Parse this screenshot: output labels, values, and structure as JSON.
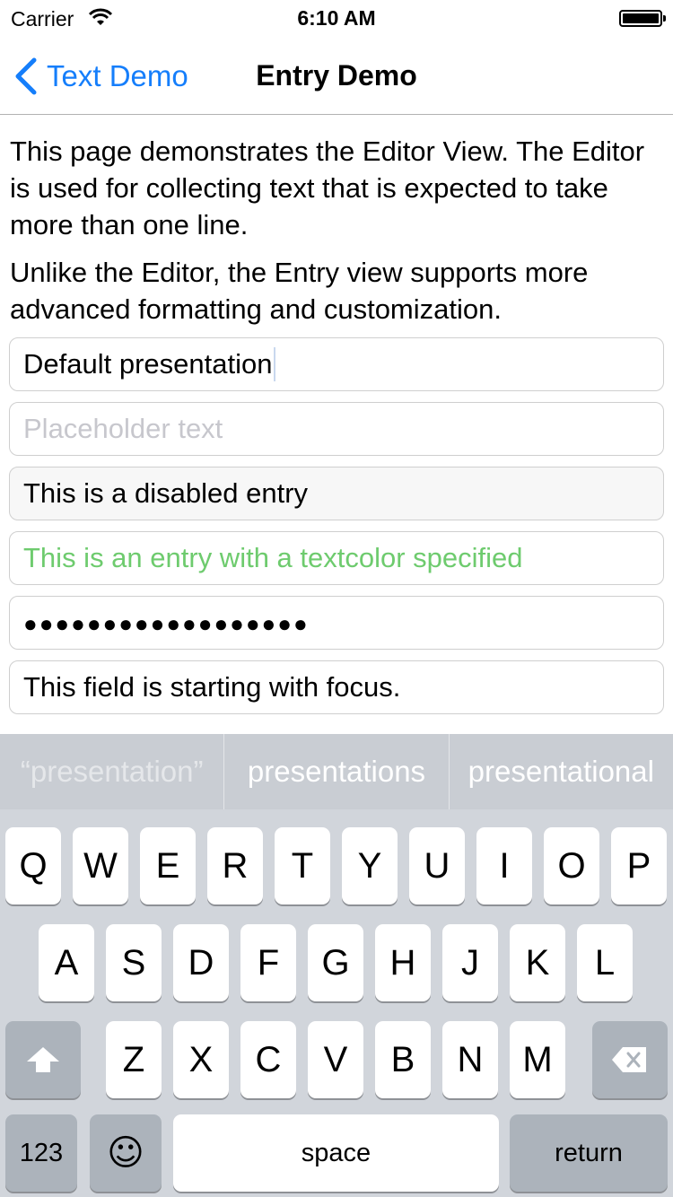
{
  "status_bar": {
    "carrier": "Carrier",
    "time": "6:10 AM"
  },
  "nav": {
    "back_label": "Text Demo",
    "title": "Entry Demo"
  },
  "content": {
    "paragraphs": [
      "This page demonstrates the Editor View. The Editor is used for collecting text that is expected to take more than one line.",
      "Unlike the Editor, the Entry view supports more advanced formatting and customization."
    ],
    "entries": {
      "default_value": "Default presentation",
      "placeholder": "Placeholder text",
      "disabled_value": "This is a disabled entry",
      "colored_value": "This is an entry with a textcolor specified",
      "colored_text_color": "#6ecb6e",
      "password_dots": "●●●●●●●●●●●●●●●●●●",
      "focus_value": "This field is starting with focus."
    }
  },
  "keyboard": {
    "suggestions": [
      "“presentation”",
      "presentations",
      "presentational"
    ],
    "row1": [
      "Q",
      "W",
      "E",
      "R",
      "T",
      "Y",
      "U",
      "I",
      "O",
      "P"
    ],
    "row2": [
      "A",
      "S",
      "D",
      "F",
      "G",
      "H",
      "J",
      "K",
      "L"
    ],
    "row3": [
      "Z",
      "X",
      "C",
      "V",
      "B",
      "N",
      "M"
    ],
    "numbers_label": "123",
    "space_label": "space",
    "return_label": "return",
    "emoji_icon": "☺",
    "accent_color": "#157efb"
  }
}
